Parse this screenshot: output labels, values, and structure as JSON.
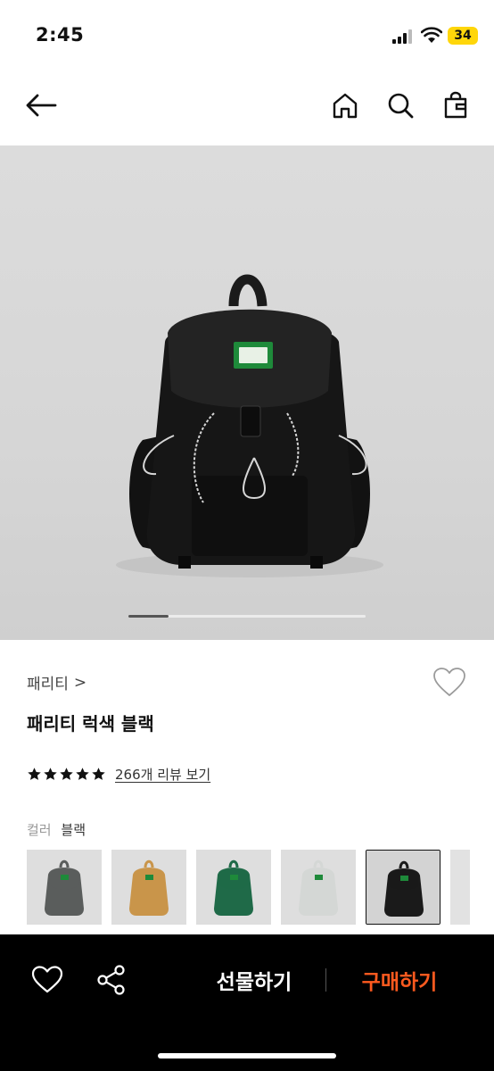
{
  "status_bar": {
    "time": "2:45",
    "battery": "34"
  },
  "product": {
    "brand": "패리티",
    "brand_chevron": ">",
    "name": "패리티 럭색 블랙",
    "rating": 5,
    "review_text": "266개 리뷰 보기",
    "carousel_progress": 0.17
  },
  "color": {
    "label": "컬러",
    "value": "블랙",
    "options": [
      {
        "color": "#5a5d5c"
      },
      {
        "color": "#c9954a"
      },
      {
        "color": "#1f6a48"
      },
      {
        "color": "#d4d7d5"
      },
      {
        "color": "#1a1a1a",
        "selected": true
      }
    ]
  },
  "bottom_bar": {
    "gift_label": "선물하기",
    "buy_label": "구매하기",
    "buy_color": "#ff5a1f"
  },
  "icons": [
    "back-arrow-icon",
    "home-icon",
    "search-icon",
    "shopping-bag-icon",
    "heart-icon",
    "share-icon",
    "star-icon"
  ]
}
